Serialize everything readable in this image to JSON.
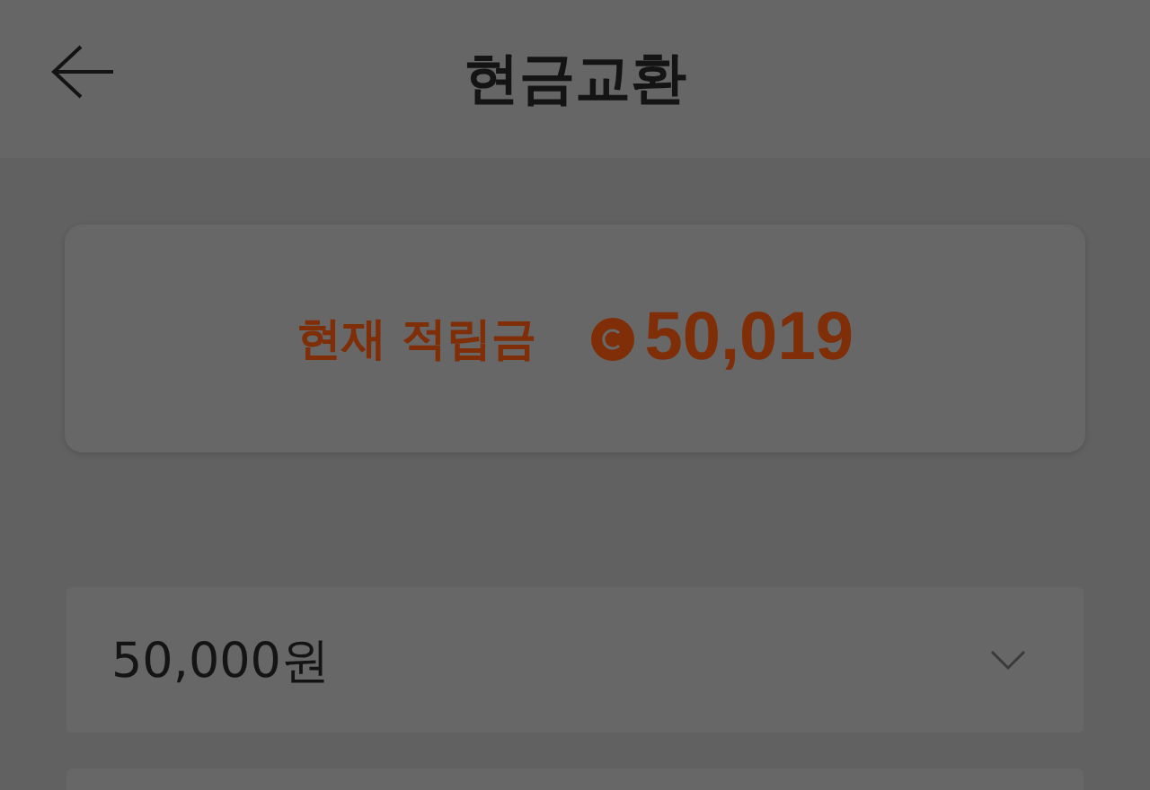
{
  "header": {
    "title": "현금교환"
  },
  "balance": {
    "label": "현재 적립금",
    "amount": "50,019"
  },
  "amount_select": {
    "value": "50,000원"
  }
}
